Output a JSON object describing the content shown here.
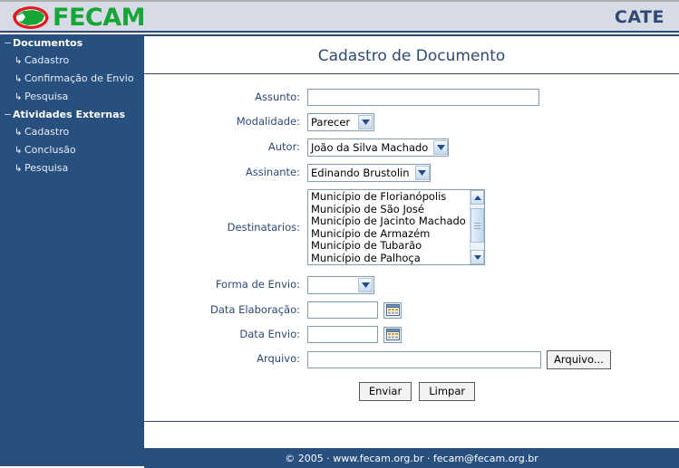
{
  "header": {
    "brand": "FECAM",
    "app_code": "CATE",
    "logo_icon": "fecam-map-logo",
    "brand_color": "#15a637",
    "app_code_color": "#2c4a74",
    "background_color": "#d6dbe5"
  },
  "sidebar": {
    "background_color": "#28507f",
    "groups": [
      {
        "label": "Documentos",
        "marker": "−",
        "items": [
          {
            "label": "Cadastro",
            "arrow": "↳"
          },
          {
            "label": "Confirmação de Envio",
            "arrow": "↳"
          },
          {
            "label": "Pesquisa",
            "arrow": "↳"
          }
        ]
      },
      {
        "label": "Atividades Externas",
        "marker": "−",
        "items": [
          {
            "label": "Cadastro",
            "arrow": "↳"
          },
          {
            "label": "Conclusão",
            "arrow": "↳"
          },
          {
            "label": "Pesquisa",
            "arrow": "↳"
          }
        ]
      }
    ]
  },
  "main": {
    "title": "Cadastro de Documento",
    "fields": {
      "assunto": {
        "label": "Assunto:",
        "value": "",
        "placeholder": ""
      },
      "modalidade": {
        "label": "Modalidade:",
        "value": "Parecer"
      },
      "autor": {
        "label": "Autor:",
        "value": "João da Silva Machado"
      },
      "assinante": {
        "label": "Assinante:",
        "value": "Edinando Brustolin"
      },
      "destinatarios": {
        "label": "Destinatarios:",
        "options": [
          "Município de Florianópolis",
          "Município de São José",
          "Município de Jacinto Machado",
          "Município de Armazém",
          "Município de Tubarão",
          "Município de Palhoça"
        ]
      },
      "forma_envio": {
        "label": "Forma de Envio:",
        "value": ""
      },
      "data_elaboracao": {
        "label": "Data Elaboração:",
        "value": "",
        "picker_icon": "calendar-icon"
      },
      "data_envio": {
        "label": "Data Envio:",
        "value": "",
        "picker_icon": "calendar-icon"
      },
      "arquivo": {
        "label": "Arquivo:",
        "value": "",
        "browse_label": "Arquivo..."
      }
    },
    "buttons": {
      "submit": "Enviar",
      "reset": "Limpar"
    }
  },
  "footer": {
    "text": "© 2005 · www.fecam.org.br · fecam@fecam.org.br",
    "background_color": "#28507f"
  }
}
